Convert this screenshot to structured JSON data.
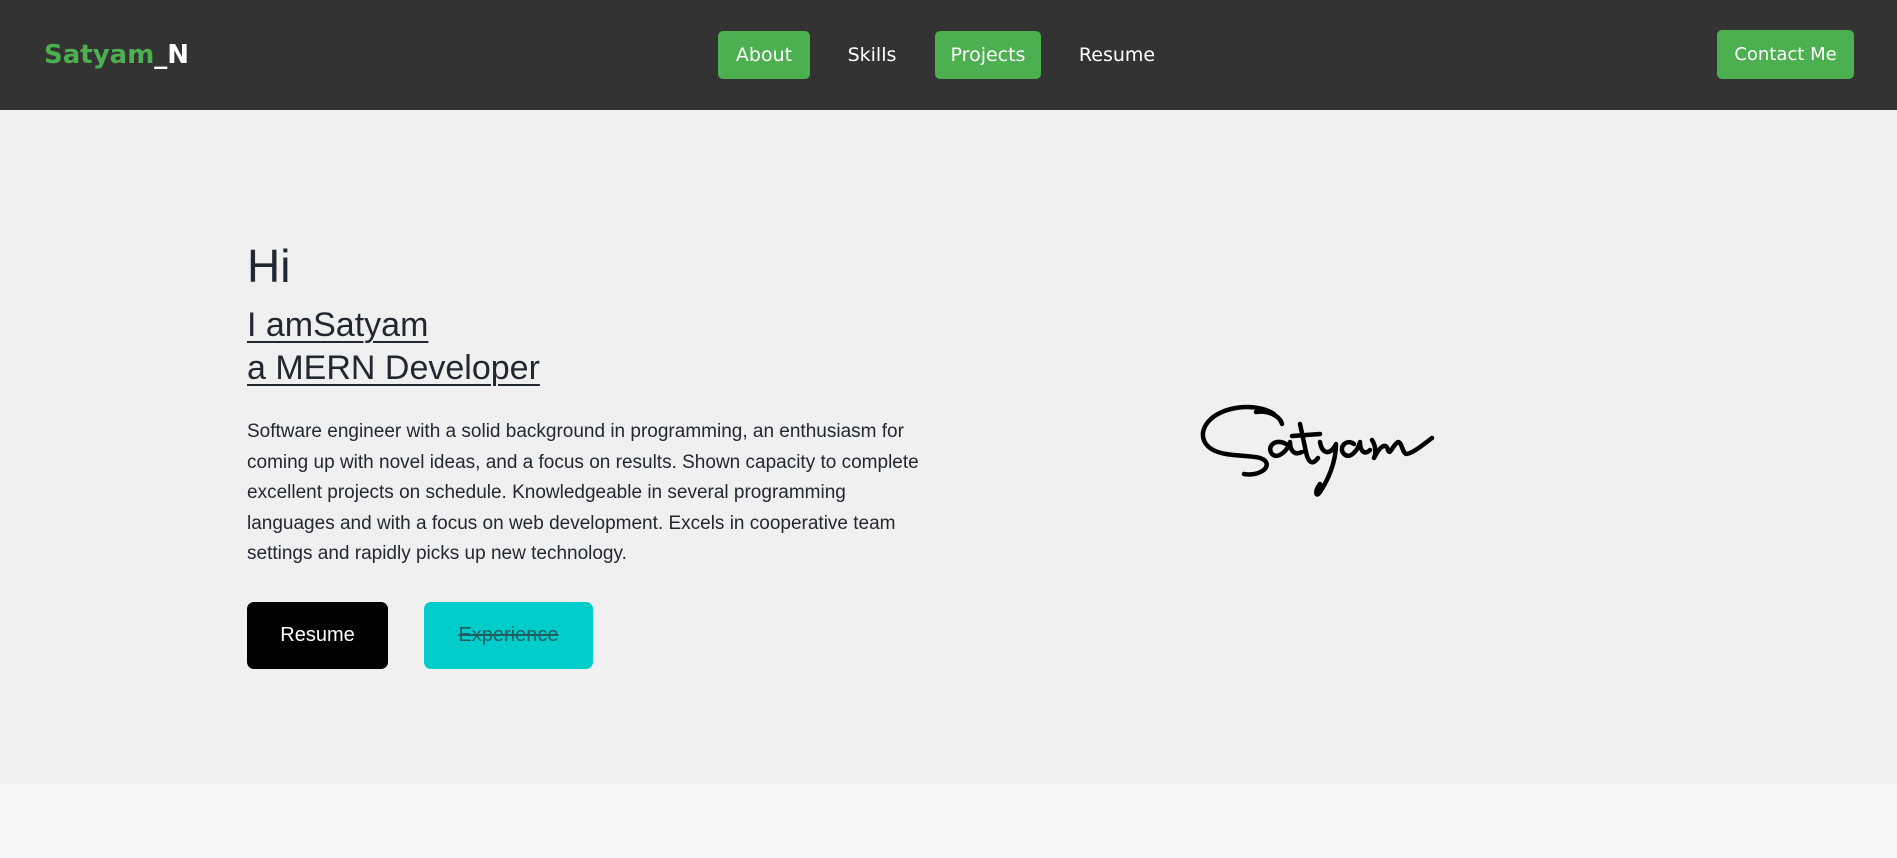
{
  "navbar": {
    "brand_part1": "Satyam",
    "brand_part2": "_N",
    "items": [
      {
        "label": "About",
        "active": true
      },
      {
        "label": "Skills",
        "active": false
      },
      {
        "label": "Projects",
        "active": true
      },
      {
        "label": "Resume",
        "active": false
      }
    ],
    "contact_label": "Contact Me"
  },
  "hero": {
    "greeting": "Hi",
    "intro_line1": "I amSatyam",
    "intro_line2": "a MERN Developer",
    "description": "Software engineer with a solid background in programming, an enthusiasm for coming up with novel ideas, and a focus on results. Shown capacity to complete excellent projects on schedule. Knowledgeable in several programming languages and with a focus on web development. Excels in cooperative team settings and rapidly picks up new technology.",
    "resume_button": "Resume",
    "experience_button": "Experience",
    "signature_text": "Satyam"
  },
  "colors": {
    "navbar_bg": "#333333",
    "accent_green": "#4caf50",
    "hero_bg": "#f0f0f0",
    "experience_cyan": "#00cccc"
  }
}
